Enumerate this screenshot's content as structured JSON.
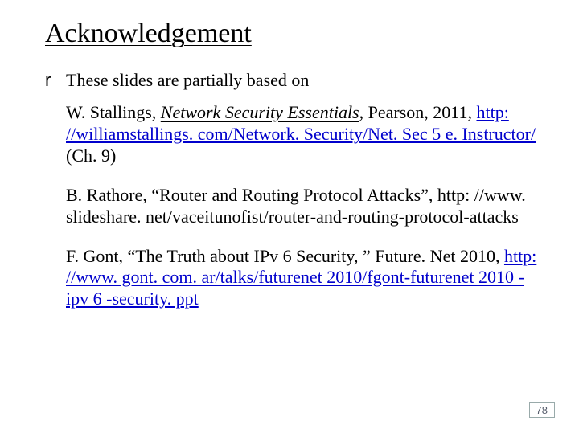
{
  "title": "Acknowledgement",
  "bullet": {
    "glyph": "r",
    "text": "These slides are partially based on"
  },
  "refs": {
    "stallings": {
      "author": "W. Stallings, ",
      "title_italic_ul": "Network Security Essentials",
      "after_title": ", Pearson, 2011, ",
      "link_text": "http: //williamstallings. com/Network. Security/Net. Sec 5 e. Instructor/",
      "tail": " (Ch. 9)"
    },
    "rathore": {
      "line": "B. Rathore, “Router and Routing Protocol Attacks”, http: //www. slideshare. net/vaceitunofist/router-and-routing-protocol-attacks"
    },
    "gont": {
      "prefix": "F. Gont, “The Truth about IPv 6 Security, ” Future. Net 2010, ",
      "link_text": "http: //www. gont. com. ar/talks/futurenet 2010/fgont-futurenet 2010 -ipv 6 -security. ppt"
    }
  },
  "page_number": "78"
}
